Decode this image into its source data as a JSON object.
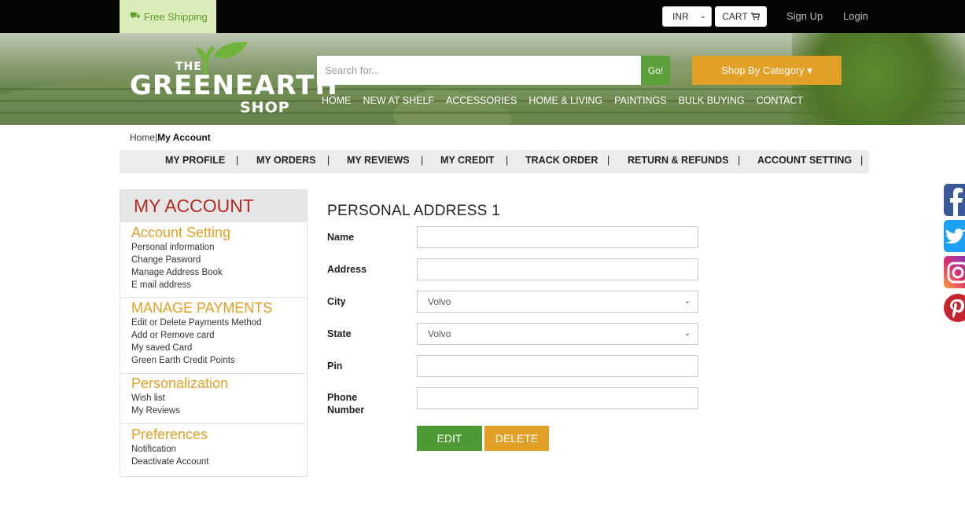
{
  "topbar": {
    "free_shipping": "Free Shipping",
    "currency": "INR",
    "cart": "CART",
    "sign_up": "Sign Up",
    "login": "Login"
  },
  "logo": {
    "the": "THE",
    "green_earth": "GREENEARTH",
    "shop": "SHOP"
  },
  "search": {
    "placeholder": "Search for...",
    "go": "Go!"
  },
  "shop_by_category": "Shop By Category ▾",
  "mainnav": [
    "HOME",
    "NEW AT SHELF",
    "ACCESSORIES",
    "HOME & LIVING",
    "PAINTINGS",
    "BULK BUYING",
    "CONTACT"
  ],
  "breadcrumb": {
    "home": "Home",
    "sep": "|",
    "current": "My Account"
  },
  "account_nav": [
    "MY PROFILE",
    "MY ORDERS",
    "MY REVIEWS",
    "MY CREDIT",
    "TRACK ORDER",
    "RETURN & REFUNDS",
    "ACCOUNT SETTING"
  ],
  "sidebar": {
    "heading": "MY ACCOUNT",
    "sections": [
      {
        "title": "Account Setting",
        "items": [
          "Personal information",
          "Change Pasword",
          "Manage Address Book",
          "E mail address"
        ]
      },
      {
        "title": "MANAGE PAYMENTS",
        "items": [
          "Edit or Delete Payments Method",
          "Add or Remove card",
          "My saved Card",
          "Green Earth Credit Points"
        ]
      },
      {
        "title": "Personalization",
        "items": [
          "Wish list",
          "My Reviews"
        ]
      },
      {
        "title": "Preferences",
        "items": [
          "Notification",
          "Deactivate Account"
        ]
      }
    ]
  },
  "form": {
    "title": "PERSONAL ADDRESS 1",
    "name_label": "Name",
    "address_label": "Address",
    "city_label": "City",
    "city_value": "Volvo",
    "state_label": "State",
    "state_value": "Volvo",
    "pin_label": "Pin",
    "phone_label_1": "Phone",
    "phone_label_2": "Number",
    "edit": "EDIT",
    "delete": "DELETE"
  },
  "colors": {
    "brand_green": "#5aa03a",
    "brand_orange": "#e3a026",
    "heading_red": "#b32a24"
  }
}
